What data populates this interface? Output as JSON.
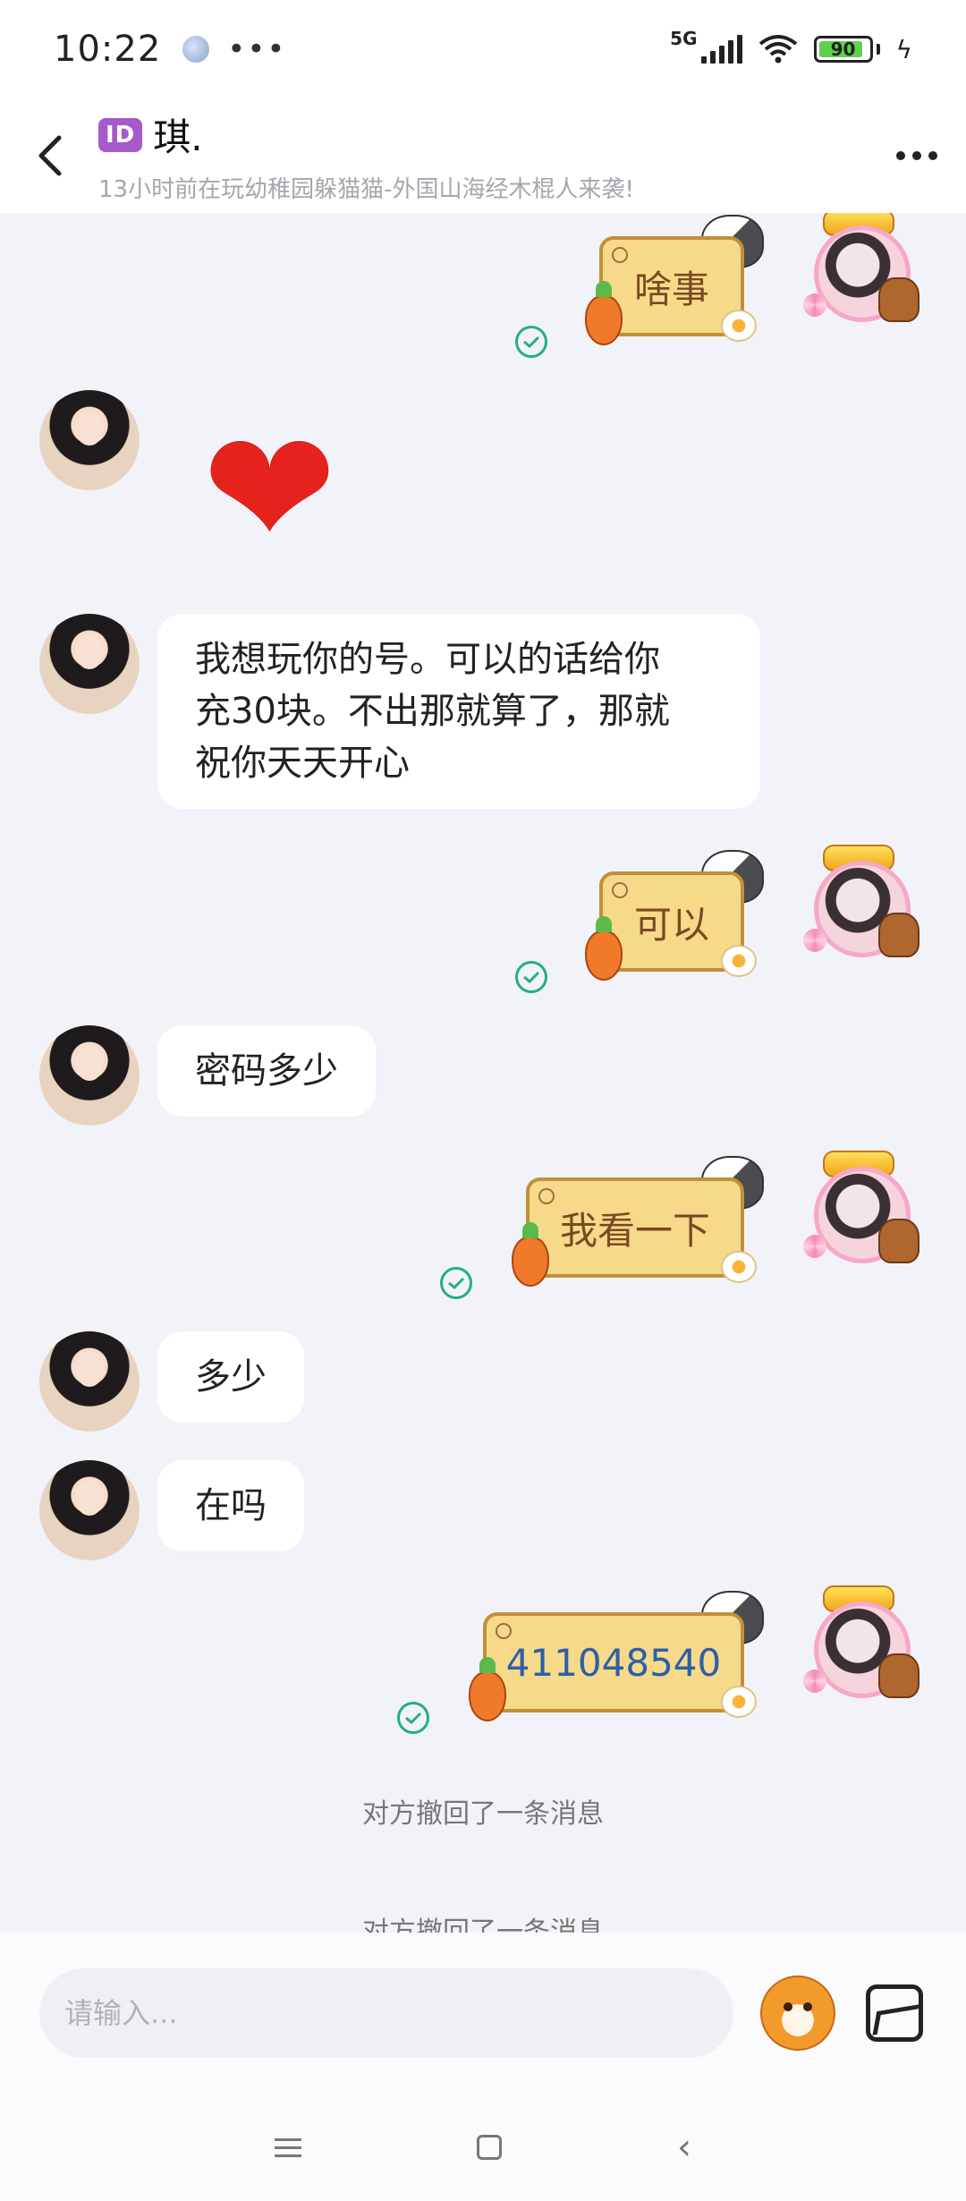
{
  "status_bar": {
    "time": "10:22",
    "menu_dots": "•••",
    "network": "5G",
    "battery": "90"
  },
  "header": {
    "badge": "ID",
    "name": "琪.",
    "status": "13小时前在玩幼稚园躲猫猫-外国山海经木棍人来袭!"
  },
  "messages": [
    {
      "side": "right",
      "kind": "sticker",
      "text": "啥事",
      "read": true
    },
    {
      "side": "left",
      "kind": "emoji",
      "text": "❤"
    },
    {
      "side": "left",
      "kind": "text",
      "lines": [
        "我想玩你的号。可以的话给你",
        "充30块。不出那就算了，那就",
        "祝你天天开心"
      ]
    },
    {
      "side": "right",
      "kind": "sticker",
      "text": "可以",
      "read": true
    },
    {
      "side": "left",
      "kind": "text",
      "text": "密码多少"
    },
    {
      "side": "right",
      "kind": "sticker",
      "text": "我看一下",
      "read": true
    },
    {
      "side": "left",
      "kind": "text",
      "text": "多少"
    },
    {
      "side": "left",
      "kind": "text",
      "text": "在吗"
    },
    {
      "side": "right",
      "kind": "sticker",
      "text": "411048540",
      "read": true
    },
    {
      "side": "system",
      "text": "对方撤回了一条消息"
    },
    {
      "side": "system",
      "text": "对方撤回了一条消息"
    }
  ],
  "input": {
    "placeholder": "请输入..."
  },
  "icons": {
    "back": "chevron-left-icon",
    "more": "more-horizontal-icon",
    "emoji": "emoji-sticker-icon",
    "image": "image-icon",
    "read": "check-circle-icon"
  },
  "colors": {
    "background": "#f2f3f8",
    "sticker_fill": "#f7d98a",
    "read_check": "#23b07d",
    "id_badge": "#a75ac9"
  }
}
